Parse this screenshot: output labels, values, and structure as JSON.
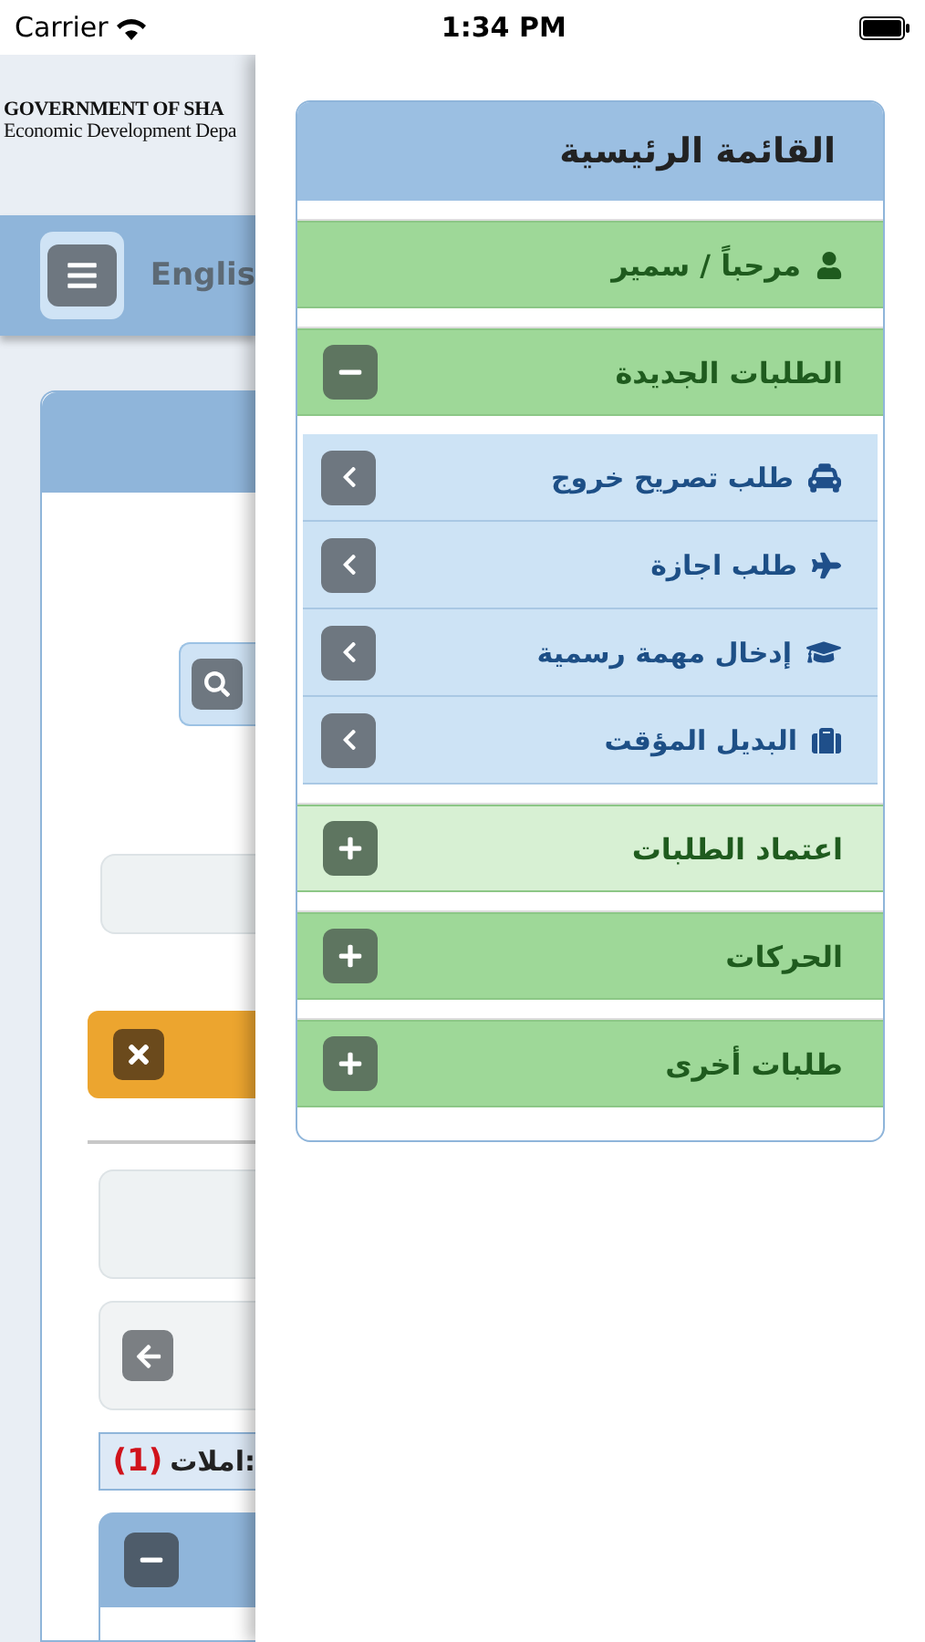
{
  "status_bar": {
    "carrier": "Carrier",
    "time": "1:34 PM"
  },
  "background_page": {
    "header_title": "GOVERNMENT OF SHA",
    "header_subtitle": "Economic Development Depa",
    "language_link": "Englis",
    "count_label": "املات:",
    "count_value": "(1)"
  },
  "menu": {
    "title": "القائمة الرئيسية",
    "welcome": "مرحباً / سمير",
    "sections": [
      {
        "label": "الطلبات الجديدة",
        "expanded": true,
        "selected": false,
        "items": [
          {
            "label": "طلب تصريح خروج"
          },
          {
            "label": "طلب اجازة"
          },
          {
            "label": "إدخال مهمة رسمية"
          },
          {
            "label": "البديل المؤقت"
          }
        ]
      },
      {
        "label": "اعتماد الطلبات",
        "expanded": false,
        "selected": true
      },
      {
        "label": "الحركات",
        "expanded": false,
        "selected": false
      },
      {
        "label": "طلبات أخرى",
        "expanded": false,
        "selected": false
      }
    ]
  }
}
